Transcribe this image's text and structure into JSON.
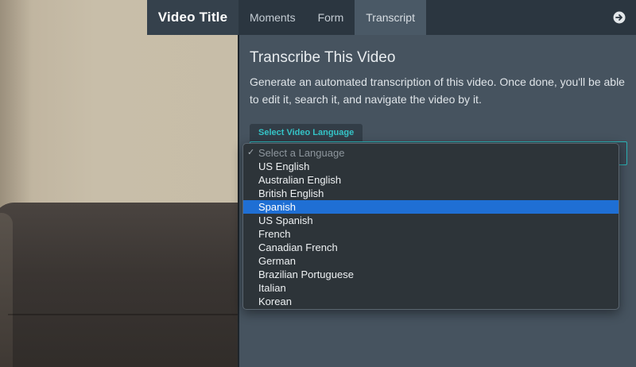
{
  "header": {
    "title": "Video Title",
    "tabs": [
      {
        "label": "Moments"
      },
      {
        "label": "Form"
      },
      {
        "label": "Transcript"
      }
    ]
  },
  "panel": {
    "heading": "Transcribe This Video",
    "description": "Generate an automated transcription of this video. Once done, you'll be able to edit it, search it, and navigate the video by it.",
    "language_label": "Select Video Language"
  },
  "dropdown": {
    "checkmark": "✓",
    "options": [
      {
        "label": "Select a Language"
      },
      {
        "label": "US English"
      },
      {
        "label": "Australian English"
      },
      {
        "label": "British English"
      },
      {
        "label": "Spanish"
      },
      {
        "label": "US Spanish"
      },
      {
        "label": "French"
      },
      {
        "label": "Canadian French"
      },
      {
        "label": "German"
      },
      {
        "label": "Brazilian Portuguese"
      },
      {
        "label": "Italian"
      },
      {
        "label": "Korean"
      }
    ]
  },
  "colors": {
    "accent": "#35c3c6",
    "selection": "#1f6fd4",
    "panel": "#46535f",
    "topbar": "#2b3640"
  }
}
